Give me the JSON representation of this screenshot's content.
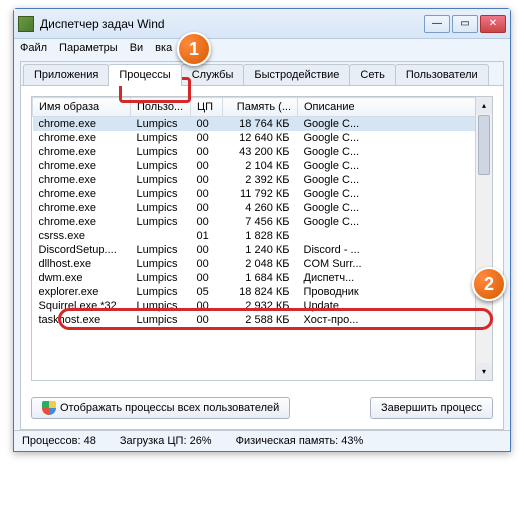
{
  "window": {
    "title": "Диспетчер задач Wind"
  },
  "menu": {
    "file": "Файл",
    "params": "Параметры",
    "view": "Ви",
    "help": "вка"
  },
  "tabs": {
    "apps": "Приложения",
    "processes": "Процессы",
    "services": "Службы",
    "perf": "Быстродействие",
    "net": "Сеть",
    "users": "Пользователи"
  },
  "headers": {
    "image": "Имя образа",
    "user": "Пользо...",
    "cpu": "ЦП",
    "memory": "Память (...",
    "desc": "Описание"
  },
  "rows": [
    {
      "img": "chrome.exe",
      "user": "Lumpics",
      "cpu": "00",
      "mem": "18 764 КБ",
      "desc": "Google C...",
      "sel": true
    },
    {
      "img": "chrome.exe",
      "user": "Lumpics",
      "cpu": "00",
      "mem": "12 640 КБ",
      "desc": "Google C..."
    },
    {
      "img": "chrome.exe",
      "user": "Lumpics",
      "cpu": "00",
      "mem": "43 200 КБ",
      "desc": "Google C..."
    },
    {
      "img": "chrome.exe",
      "user": "Lumpics",
      "cpu": "00",
      "mem": "2 104 КБ",
      "desc": "Google C..."
    },
    {
      "img": "chrome.exe",
      "user": "Lumpics",
      "cpu": "00",
      "mem": "2 392 КБ",
      "desc": "Google C..."
    },
    {
      "img": "chrome.exe",
      "user": "Lumpics",
      "cpu": "00",
      "mem": "11 792 КБ",
      "desc": "Google C..."
    },
    {
      "img": "chrome.exe",
      "user": "Lumpics",
      "cpu": "00",
      "mem": "4 260 КБ",
      "desc": "Google C..."
    },
    {
      "img": "chrome.exe",
      "user": "Lumpics",
      "cpu": "00",
      "mem": "7 456 КБ",
      "desc": "Google C..."
    },
    {
      "img": "csrss.exe",
      "user": "",
      "cpu": "01",
      "mem": "1 828 КБ",
      "desc": ""
    },
    {
      "img": "DiscordSetup....",
      "user": "Lumpics",
      "cpu": "00",
      "mem": "1 240 КБ",
      "desc": "Discord - ..."
    },
    {
      "img": "dllhost.exe",
      "user": "Lumpics",
      "cpu": "00",
      "mem": "2 048 КБ",
      "desc": "COM Surr..."
    },
    {
      "img": "dwm.exe",
      "user": "Lumpics",
      "cpu": "00",
      "mem": "1 684 КБ",
      "desc": "Диспетч..."
    },
    {
      "img": "explorer.exe",
      "user": "Lumpics",
      "cpu": "05",
      "mem": "18 824 КБ",
      "desc": "Проводник"
    },
    {
      "img": "Squirrel.exe *32",
      "user": "Lumpics",
      "cpu": "00",
      "mem": "2 932 КБ",
      "desc": "Update"
    },
    {
      "img": "taskhost.exe",
      "user": "Lumpics",
      "cpu": "00",
      "mem": "2 588 КБ",
      "desc": "Хост-про..."
    }
  ],
  "buttons": {
    "show_all": "Отображать процессы всех пользователей",
    "end": "Завершить процесс"
  },
  "status": {
    "proc": "Процессов: 48",
    "cpu": "Загрузка ЦП: 26%",
    "mem": "Физическая память: 43%"
  },
  "callouts": {
    "b1": "1",
    "b2": "2"
  }
}
